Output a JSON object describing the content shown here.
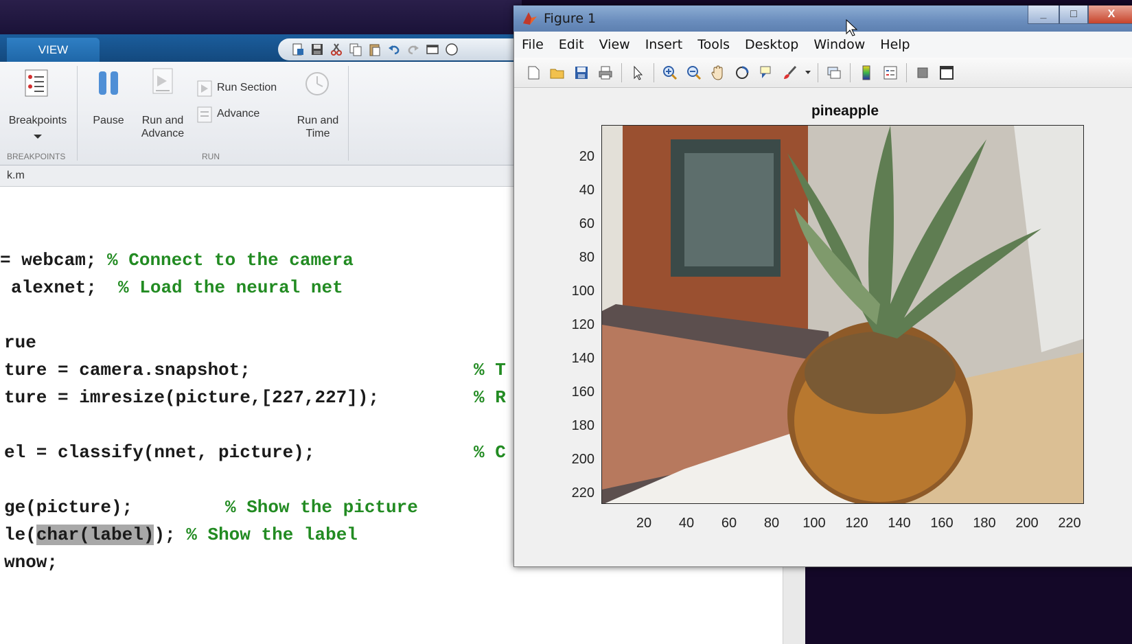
{
  "matlab": {
    "ribbon_tab": "VIEW",
    "buttons": {
      "breakpoints": "Breakpoints",
      "pause": "Pause",
      "run_and_advance": "Run and Advance",
      "run_section": "Run Section",
      "advance": "Advance",
      "run_and_time": "Run and Time"
    },
    "groups": {
      "breakpoints": "BREAKPOINTS",
      "run": "RUN"
    },
    "file_tab": "k.m",
    "code_lines": [
      {
        "code": "= webcam; ",
        "comment": "% Connect to the camera"
      },
      {
        "code": "alexnet;  ",
        "comment": "% Load the neural net"
      },
      {
        "code": "rue",
        "comment": ""
      },
      {
        "code": "ture = camera.snapshot;",
        "comment": "% T"
      },
      {
        "code": "ture = imresize(picture,[227,227]);",
        "comment": "% R"
      },
      {
        "code": "el = classify(nnet, picture);",
        "comment": "% C"
      },
      {
        "code": "ge(picture);",
        "comment": "% Show the picture"
      },
      {
        "code_pre": "le(",
        "code_hl": "char(label)",
        "code_post": "); ",
        "comment": "% Show the label"
      },
      {
        "code": "wnow;",
        "comment": ""
      }
    ]
  },
  "figure": {
    "window_title": "Figure 1",
    "menu": [
      "File",
      "Edit",
      "View",
      "Insert",
      "Tools",
      "Desktop",
      "Window",
      "Help"
    ],
    "plot_title": "pineapple",
    "y_ticks": [
      "20",
      "40",
      "60",
      "80",
      "100",
      "120",
      "140",
      "160",
      "180",
      "200",
      "220"
    ],
    "x_ticks": [
      "20",
      "40",
      "60",
      "80",
      "100",
      "120",
      "140",
      "160",
      "180",
      "200",
      "220"
    ],
    "window_controls": {
      "minimize": "_",
      "maximize": "□",
      "close": "X"
    }
  },
  "colors": {
    "comment_green": "#228b22",
    "ribbon_blue": "#1b5d9c",
    "selection_gray": "#a8a8a8"
  }
}
